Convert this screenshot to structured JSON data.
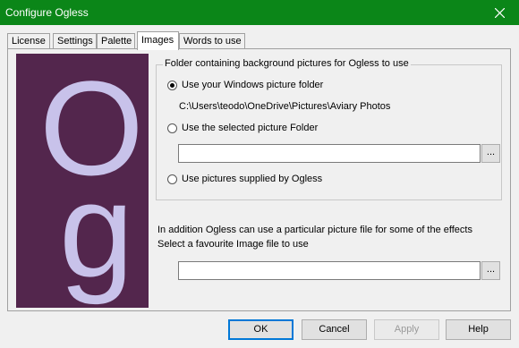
{
  "window": {
    "title": "Configure Ogless",
    "close_glyph": "✕"
  },
  "tabs": [
    {
      "label": "License",
      "active": false
    },
    {
      "label": "Settings",
      "active": false
    },
    {
      "label": "Palette",
      "active": false
    },
    {
      "label": "Images",
      "active": true
    },
    {
      "label": "Words to use",
      "active": false
    }
  ],
  "preview": {
    "text_top": "O",
    "text_bottom": "g",
    "bg_color": "#53264d",
    "glyph_color": "#c8c2ea"
  },
  "folder_group": {
    "label": "Folder containing background pictures for Ogless to use",
    "option_windows": "Use your Windows picture folder",
    "windows_path": "C:\\Users\\teodo\\OneDrive\\Pictures\\Aviary Photos",
    "option_selected": "Use the selected picture Folder",
    "selected_folder_value": "",
    "option_supplied": "Use pictures supplied by Ogless",
    "selected_option": "windows"
  },
  "favourite": {
    "line1": "In addition Ogless can use a particular picture file for some of the effects",
    "line2": "Select a favourite Image file to use",
    "file_value": ""
  },
  "browse_label": "...",
  "buttons": {
    "ok": "OK",
    "cancel": "Cancel",
    "apply": "Apply",
    "help": "Help"
  },
  "colors": {
    "titlebar": "#0b8618",
    "accent": "#0078d7"
  }
}
